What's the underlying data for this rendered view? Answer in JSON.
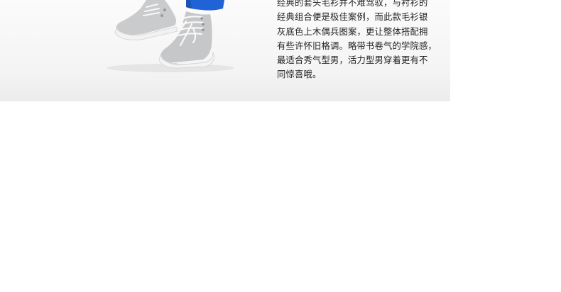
{
  "product_description": {
    "lines": [
      "经典的套头毛衫并不难驾驭，与衬衫的",
      "经典组合便是极佳案例，而此款毛衫银",
      "灰底色上木偶兵图案，更让整体搭配拥",
      "有些许怀旧格调。略带书卷气的学院感，",
      "最适合秀气型男，活力型男穿着更有不",
      "同惊喜哦。"
    ]
  },
  "colors": {
    "banner_bg": "#f4f4f4",
    "text": "#222222",
    "jeans_blue": "#1f63d6",
    "sneaker_gray": "#c9cbcc"
  },
  "icons": [
    "sneaker-photo"
  ]
}
